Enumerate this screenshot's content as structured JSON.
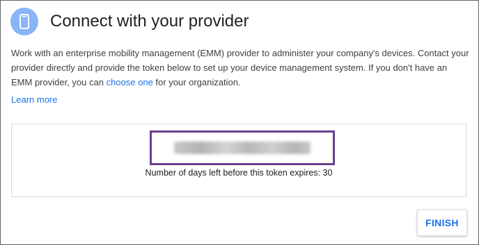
{
  "header": {
    "title": "Connect with your provider",
    "icon": "phone-icon",
    "icon_color": "#8ab4f8"
  },
  "description": {
    "text_before_link": "Work with an enterprise mobility management (EMM) provider to administer your company's devices. Contact your provider directly and provide the token below to set up your device management system. If you don't have an EMM provider, you can ",
    "link_label": "choose one",
    "text_after_link": " for your organization."
  },
  "learn_more_label": "Learn more",
  "token": {
    "expiry_text": "Number of days left before this token expires: 30",
    "highlight_color": "#6a3f8e"
  },
  "actions": {
    "finish_label": "FINISH"
  },
  "colors": {
    "link": "#1a73e8"
  }
}
